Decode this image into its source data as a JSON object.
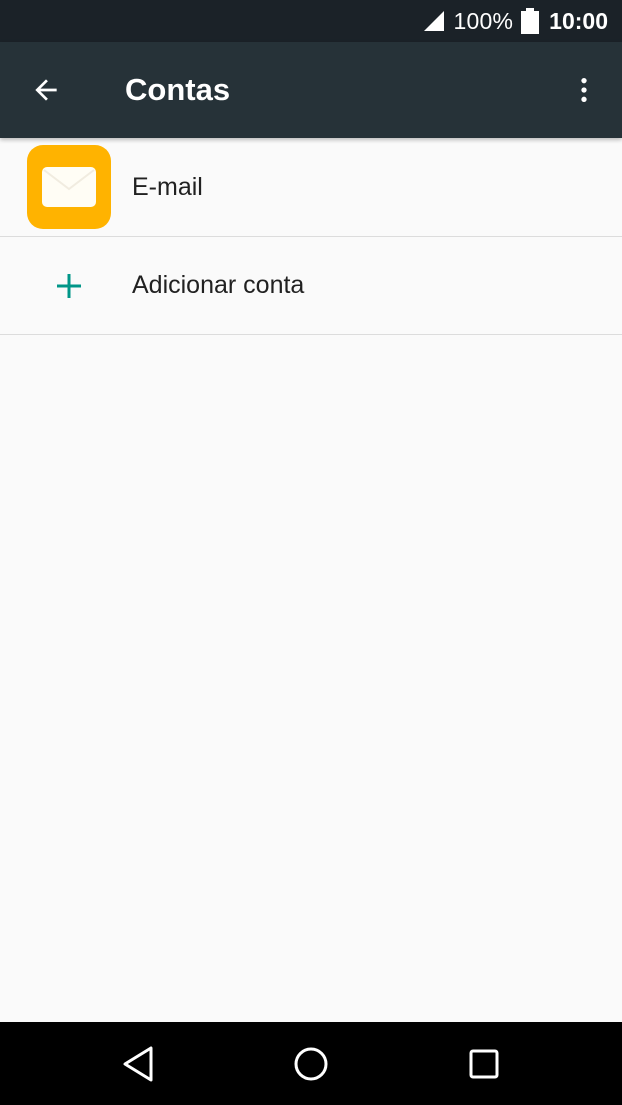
{
  "status_bar": {
    "battery_percent": "100%",
    "time": "10:00",
    "signal_icon": "cell-signal-icon",
    "battery_icon": "battery-full-icon"
  },
  "app_bar": {
    "title": "Contas",
    "back_icon": "arrow-back-icon",
    "menu_icon": "more-vert-icon",
    "background_color": "#263238"
  },
  "accounts": {
    "items": [
      {
        "label": "E-mail",
        "icon": "email-app-icon",
        "icon_color": "#ffb300"
      },
      {
        "label": "Adicionar conta",
        "icon": "plus-icon",
        "icon_color": "#009688"
      }
    ]
  },
  "nav_bar": {
    "back_icon": "nav-back-icon",
    "home_icon": "nav-home-icon",
    "recents_icon": "nav-recents-icon"
  }
}
